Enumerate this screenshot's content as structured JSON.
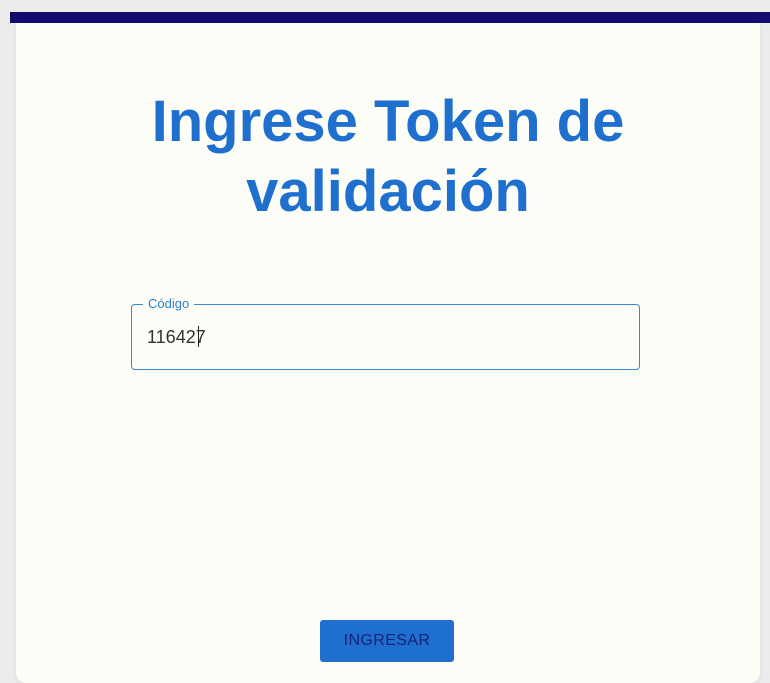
{
  "page": {
    "title": "Ingrese Token de validación"
  },
  "form": {
    "code_label": "Código",
    "code_value": "116427",
    "submit_label": "INGRESAR"
  },
  "colors": {
    "top_bar": "#140b6e",
    "primary": "#1f6fcf",
    "surface": "#fdfdf8"
  }
}
